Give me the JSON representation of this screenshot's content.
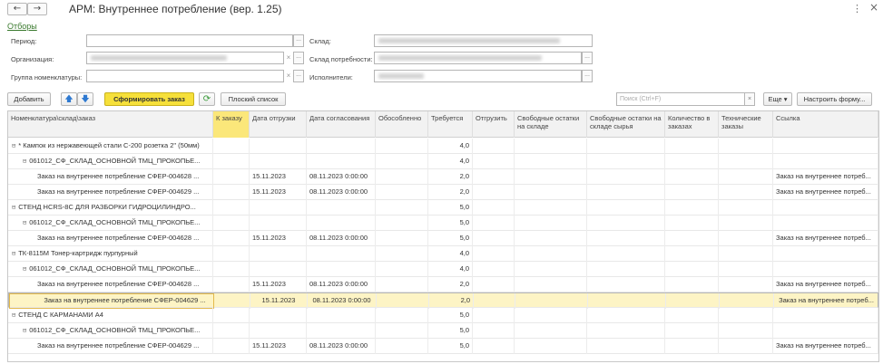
{
  "header": {
    "back_glyph": "←",
    "forward_glyph": "→",
    "title": "АРМ: Внутреннее потребление (вер. 1.25)",
    "menu_glyph": "⋮",
    "close_glyph": "×"
  },
  "filters": {
    "group_link": "Отборы",
    "period_label": "Период:",
    "org_label": "Организация:",
    "group_label": "Группа номенклатуры:",
    "warehouse_label": "Склад:",
    "consumer_warehouse_label": "Склад потребности:",
    "performers_label": "Исполнители:",
    "select_glyph": "...",
    "clear_glyph": "×"
  },
  "toolbar": {
    "add": "Добавить",
    "up": "🡅",
    "down": "🡇",
    "form_order": "Сформировать заказ",
    "refresh": "⟳",
    "flat_list": "Плоский список",
    "search_placeholder": "Поиск (Ctrl+F)",
    "search_clear": "×",
    "more": "Еще ▾",
    "configure": "Настроить форму..."
  },
  "table": {
    "columns": [
      "Номенклатура\\склад\\заказ",
      "К заказу",
      "Дата отгрузки",
      "Дата согласования",
      "Обособленно",
      "Требуется",
      "Отгрузить",
      "Свободные остатки на складе",
      "Свободные остатки на складе сырья",
      "Количество в заказах",
      "Технические заказы",
      "Ссылка"
    ],
    "rows": [
      {
        "level": 0,
        "toggle": "⊟",
        "name": "* Кампок из нержавеющей стали С-200 розетка 2\" (50мм)",
        "ship": "",
        "agree": "",
        "req": "4,0",
        "link": ""
      },
      {
        "level": 1,
        "toggle": "⊟",
        "name": "061012_СФ_СКЛАД_ОСНОВНОЙ ТМЦ_ПРОКОПЬЕ...",
        "ship": "",
        "agree": "",
        "req": "4,0",
        "link": ""
      },
      {
        "level": 2,
        "toggle": "",
        "name": "Заказ на внутреннее потребление СФЕР-004628 ...",
        "ship": "15.11.2023",
        "agree": "08.11.2023 0:00:00",
        "req": "2,0",
        "link": "Заказ на внутреннее потреб..."
      },
      {
        "level": 2,
        "toggle": "",
        "name": "Заказ на внутреннее потребление СФЕР-004629 ...",
        "ship": "15.11.2023",
        "agree": "08.11.2023 0:00:00",
        "req": "2,0",
        "link": "Заказ на внутреннее потреб..."
      },
      {
        "level": 0,
        "toggle": "⊟",
        "name": "СТЕНД HCRS-8C ДЛЯ РАЗБОРКИ ГИДРОЦИЛИНДРО...",
        "ship": "",
        "agree": "",
        "req": "5,0",
        "link": ""
      },
      {
        "level": 1,
        "toggle": "⊟",
        "name": "061012_СФ_СКЛАД_ОСНОВНОЙ ТМЦ_ПРОКОПЬЕ...",
        "ship": "",
        "agree": "",
        "req": "5,0",
        "link": ""
      },
      {
        "level": 2,
        "toggle": "",
        "name": "Заказ на внутреннее потребление СФЕР-004628 ...",
        "ship": "15.11.2023",
        "agree": "08.11.2023 0:00:00",
        "req": "5,0",
        "link": "Заказ на внутреннее потреб..."
      },
      {
        "level": 0,
        "toggle": "⊟",
        "name": "ТК-8115М Тонер-картридж пурпурный",
        "ship": "",
        "agree": "",
        "req": "4,0",
        "link": ""
      },
      {
        "level": 1,
        "toggle": "⊟",
        "name": "061012_СФ_СКЛАД_ОСНОВНОЙ ТМЦ_ПРОКОПЬЕ...",
        "ship": "",
        "agree": "",
        "req": "4,0",
        "link": ""
      },
      {
        "level": 2,
        "toggle": "",
        "name": "Заказ на внутреннее потребление СФЕР-004628 ...",
        "ship": "15.11.2023",
        "agree": "08.11.2023 0:00:00",
        "req": "2,0",
        "link": "Заказ на внутреннее потреб..."
      },
      {
        "level": 2,
        "toggle": "",
        "name": "Заказ на внутреннее потребление СФЕР-004629 ...",
        "ship": "15.11.2023",
        "agree": "08.11.2023 0:00:00",
        "req": "2,0",
        "link": "Заказ на внутреннее потреб...",
        "selected": true
      },
      {
        "level": 0,
        "toggle": "⊟",
        "name": "СТЕНД С КАРМАНАМИ А4",
        "ship": "",
        "agree": "",
        "req": "5,0",
        "link": ""
      },
      {
        "level": 1,
        "toggle": "⊟",
        "name": "061012_СФ_СКЛАД_ОСНОВНОЙ ТМЦ_ПРОКОПЬЕ...",
        "ship": "",
        "agree": "",
        "req": "5,0",
        "link": ""
      },
      {
        "level": 2,
        "toggle": "",
        "name": "Заказ на внутреннее потребление СФЕР-004629 ...",
        "ship": "15.11.2023",
        "agree": "08.11.2023 0:00:00",
        "req": "5,0",
        "link": "Заказ на внутреннее потреб..."
      }
    ]
  },
  "colors": {
    "accent_yellow": "#f6e03a",
    "selected_row": "#fdf4c5",
    "link_green": "#3a7a2e",
    "arrow_blue": "#2f7ad1"
  }
}
